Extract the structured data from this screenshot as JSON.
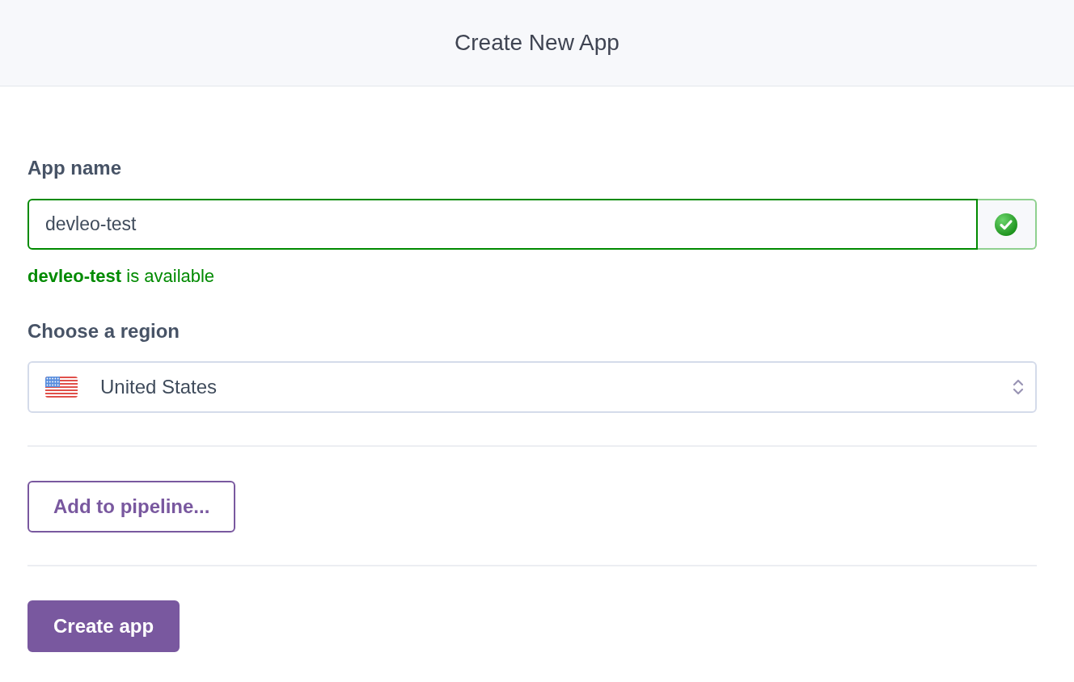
{
  "header": {
    "title": "Create New App"
  },
  "app_name": {
    "label": "App name",
    "value": "devleo-test",
    "valid": true,
    "message": "**devleo-test** is available"
  },
  "region": {
    "label": "Choose a region",
    "value": "United States"
  },
  "buttons": [
    {
      "label": "Add to pipeline...",
      "kind": "outline"
    },
    {
      "label": "Create app",
      "kind": "primary"
    }
  ]
}
